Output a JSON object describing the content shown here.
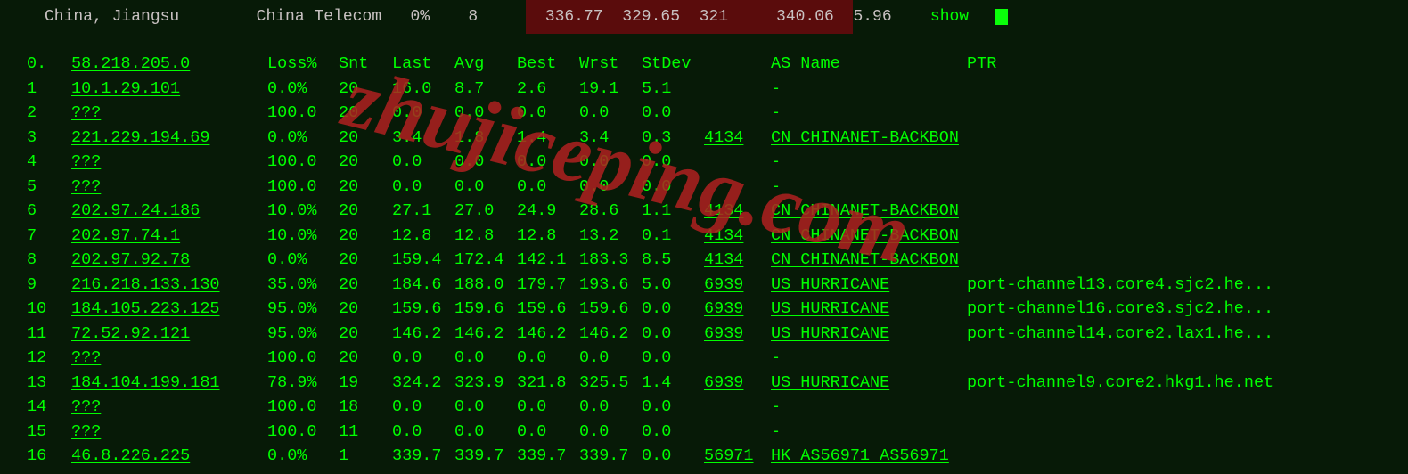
{
  "topbar": {
    "location": "China, Jiangsu",
    "isp": "China Telecom",
    "loss": "0%",
    "hops": "8",
    "last": "336.77",
    "avg": "329.65",
    "best": "321",
    "wrst": "340.06",
    "stdev": "5.96",
    "action": "show"
  },
  "headers": {
    "hop": "0.",
    "ip": "58.218.205.0",
    "loss": "Loss%",
    "snt": "Snt",
    "last": "Last",
    "avg": "Avg",
    "best": "Best",
    "wrst": "Wrst",
    "stdev": "StDev",
    "asname": "AS Name",
    "ptr": "PTR"
  },
  "hops": [
    {
      "n": "1",
      "ip": "10.1.29.101",
      "loss": "0.0%",
      "snt": "20",
      "last": "16.0",
      "avg": "8.7",
      "best": "2.6",
      "wrst": "19.1",
      "stdev": "5.1",
      "asn": "",
      "asname": "-",
      "ptr": ""
    },
    {
      "n": "2",
      "ip": "???",
      "loss": "100.0",
      "snt": "20",
      "last": "0.0",
      "avg": "0.0",
      "best": "0.0",
      "wrst": "0.0",
      "stdev": "0.0",
      "asn": "",
      "asname": "-",
      "ptr": ""
    },
    {
      "n": "3",
      "ip": "221.229.194.69",
      "loss": "0.0%",
      "snt": "20",
      "last": "3.4",
      "avg": "1.8",
      "best": "1.4",
      "wrst": "3.4",
      "stdev": "0.3",
      "asn": "4134",
      "asname": "CN CHINANET-BACKBON",
      "ptr": ""
    },
    {
      "n": "4",
      "ip": "???",
      "loss": "100.0",
      "snt": "20",
      "last": "0.0",
      "avg": "0.0",
      "best": "0.0",
      "wrst": "0.0",
      "stdev": "0.0",
      "asn": "",
      "asname": "-",
      "ptr": ""
    },
    {
      "n": "5",
      "ip": "???",
      "loss": "100.0",
      "snt": "20",
      "last": "0.0",
      "avg": "0.0",
      "best": "0.0",
      "wrst": "0.0",
      "stdev": "0.0",
      "asn": "",
      "asname": "-",
      "ptr": ""
    },
    {
      "n": "6",
      "ip": "202.97.24.186",
      "loss": "10.0%",
      "snt": "20",
      "last": "27.1",
      "avg": "27.0",
      "best": "24.9",
      "wrst": "28.6",
      "stdev": "1.1",
      "asn": "4134",
      "asname": "CN CHINANET-BACKBON",
      "ptr": ""
    },
    {
      "n": "7",
      "ip": "202.97.74.1",
      "loss": "10.0%",
      "snt": "20",
      "last": "12.8",
      "avg": "12.8",
      "best": "12.8",
      "wrst": "13.2",
      "stdev": "0.1",
      "asn": "4134",
      "asname": "CN CHINANET-BACKBON",
      "ptr": ""
    },
    {
      "n": "8",
      "ip": "202.97.92.78",
      "loss": "0.0%",
      "snt": "20",
      "last": "159.4",
      "avg": "172.4",
      "best": "142.1",
      "wrst": "183.3",
      "stdev": "8.5",
      "asn": "4134",
      "asname": "CN CHINANET-BACKBON",
      "ptr": ""
    },
    {
      "n": "9",
      "ip": "216.218.133.130",
      "loss": "35.0%",
      "snt": "20",
      "last": "184.6",
      "avg": "188.0",
      "best": "179.7",
      "wrst": "193.6",
      "stdev": "5.0",
      "asn": "6939",
      "asname": "US HURRICANE",
      "ptr": "port-channel13.core4.sjc2.he..."
    },
    {
      "n": "10",
      "ip": "184.105.223.125",
      "loss": "95.0%",
      "snt": "20",
      "last": "159.6",
      "avg": "159.6",
      "best": "159.6",
      "wrst": "159.6",
      "stdev": "0.0",
      "asn": "6939",
      "asname": "US HURRICANE",
      "ptr": "port-channel16.core3.sjc2.he..."
    },
    {
      "n": "11",
      "ip": "72.52.92.121",
      "loss": "95.0%",
      "snt": "20",
      "last": "146.2",
      "avg": "146.2",
      "best": "146.2",
      "wrst": "146.2",
      "stdev": "0.0",
      "asn": "6939",
      "asname": "US HURRICANE",
      "ptr": "port-channel14.core2.lax1.he..."
    },
    {
      "n": "12",
      "ip": "???",
      "loss": "100.0",
      "snt": "20",
      "last": "0.0",
      "avg": "0.0",
      "best": "0.0",
      "wrst": "0.0",
      "stdev": "0.0",
      "asn": "",
      "asname": "-",
      "ptr": ""
    },
    {
      "n": "13",
      "ip": "184.104.199.181",
      "loss": "78.9%",
      "snt": "19",
      "last": "324.2",
      "avg": "323.9",
      "best": "321.8",
      "wrst": "325.5",
      "stdev": "1.4",
      "asn": "6939",
      "asname": "US HURRICANE",
      "ptr": "port-channel9.core2.hkg1.he.net"
    },
    {
      "n": "14",
      "ip": "???",
      "loss": "100.0",
      "snt": "18",
      "last": "0.0",
      "avg": "0.0",
      "best": "0.0",
      "wrst": "0.0",
      "stdev": "0.0",
      "asn": "",
      "asname": "-",
      "ptr": ""
    },
    {
      "n": "15",
      "ip": "???",
      "loss": "100.0",
      "snt": "11",
      "last": "0.0",
      "avg": "0.0",
      "best": "0.0",
      "wrst": "0.0",
      "stdev": "0.0",
      "asn": "",
      "asname": "-",
      "ptr": ""
    },
    {
      "n": "16",
      "ip": "46.8.226.225",
      "loss": "0.0%",
      "snt": "1",
      "last": "339.7",
      "avg": "339.7",
      "best": "339.7",
      "wrst": "339.7",
      "stdev": "0.0",
      "asn": "56971",
      "asname": "HK AS56971 AS56971",
      "ptr": ""
    }
  ],
  "watermark": "zhujiceping.com"
}
